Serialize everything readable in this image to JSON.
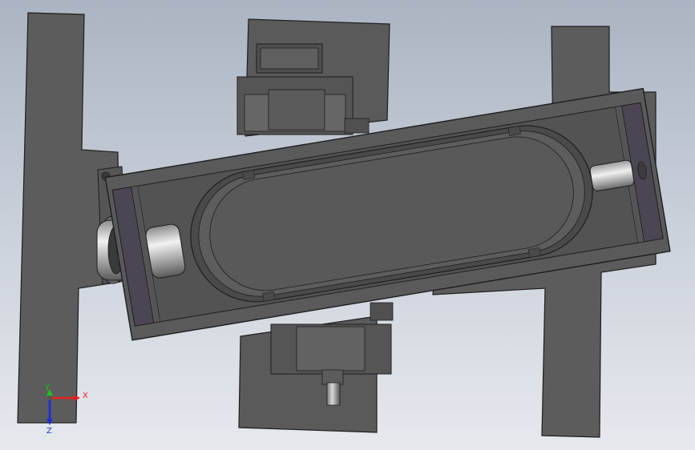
{
  "viewport": {
    "background_top": "#aab4c2",
    "background_bottom": "#e6e9ee"
  },
  "model": {
    "part_color": "#5c5c5c",
    "part_dark": "#4a4a4a",
    "edge_color": "#1e1e1e",
    "bearing_color": "#d8d8d8"
  },
  "triad": {
    "x_label": "X",
    "y_label": "Y",
    "z_label": "Z",
    "x_color": "#e02020",
    "y_color": "#20c020",
    "z_color": "#2030d0"
  }
}
